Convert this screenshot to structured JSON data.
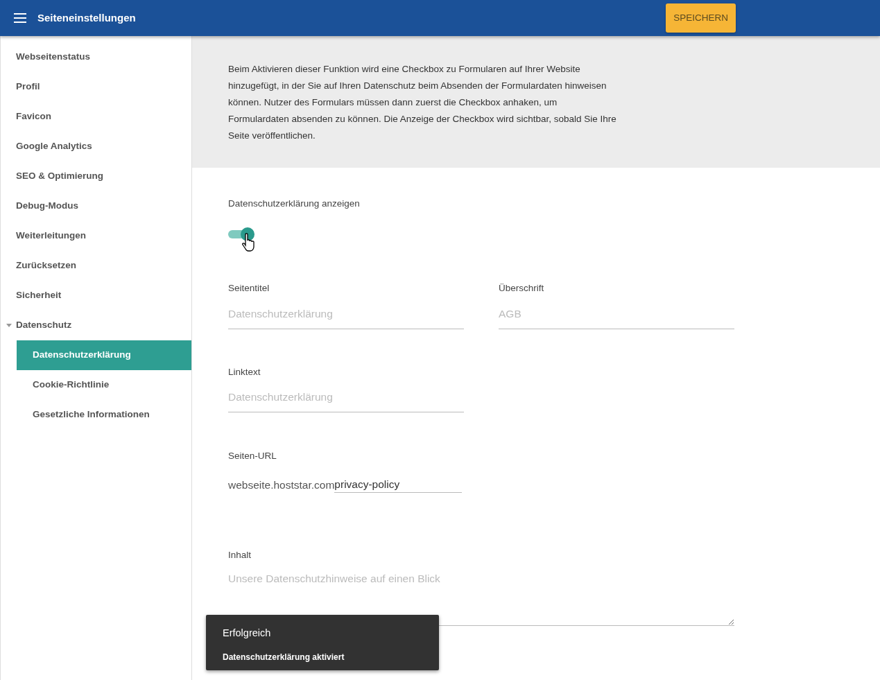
{
  "header": {
    "title": "Seiteneinstellungen",
    "save_button": "SPEICHERN"
  },
  "sidebar": {
    "items": [
      {
        "label": "Webseitenstatus",
        "selected": false
      },
      {
        "label": "Profil",
        "selected": false
      },
      {
        "label": "Favicon",
        "selected": false
      },
      {
        "label": "Google Analytics",
        "selected": false
      },
      {
        "label": "SEO & Optimierung",
        "selected": false
      },
      {
        "label": "Debug-Modus",
        "selected": false
      },
      {
        "label": "Weiterleitungen",
        "selected": false
      },
      {
        "label": "Zurücksetzen",
        "selected": false
      },
      {
        "label": "Sicherheit",
        "selected": false
      },
      {
        "label": "Datenschutz",
        "selected": false,
        "expanded": true,
        "children": [
          {
            "label": "Datenschutzerklärung",
            "selected": true
          },
          {
            "label": "Cookie-Richtlinie",
            "selected": false
          },
          {
            "label": "Gesetzliche Informationen",
            "selected": false
          }
        ]
      }
    ]
  },
  "info_text": "Beim Aktivieren dieser Funktion wird eine Checkbox zu Formularen auf Ihrer Website hinzugefügt, in der Sie auf Ihren Datenschutz beim Absenden der Formulardaten hinweisen können. Nutzer des Formulars müssen dann zuerst die Checkbox anhaken, um Formulardaten absenden zu können. Die Anzeige der Checkbox wird sichtbar, sobald Sie Ihre Seite veröffentlichen.",
  "toggle": {
    "label": "Datenschutzerklärung anzeigen",
    "on": true
  },
  "fields": [
    {
      "label": "Seitentitel",
      "placeholder": "Datenschutzerklärung"
    },
    {
      "label": "Überschrift",
      "placeholder": "AGB"
    },
    {
      "label": "Linktext",
      "placeholder": "Datenschutzerklärung"
    }
  ],
  "url_field": {
    "label": "Seiten-URL",
    "prefix": "webseite.hoststar.com",
    "value": "privacy-policy"
  },
  "content_field": {
    "label": "Inhalt",
    "placeholder": "Unsere Datenschutzhinweise auf einen Blick"
  },
  "toast": {
    "title": "Erfolgreich",
    "message": "Datenschutzerklärung aktiviert"
  }
}
